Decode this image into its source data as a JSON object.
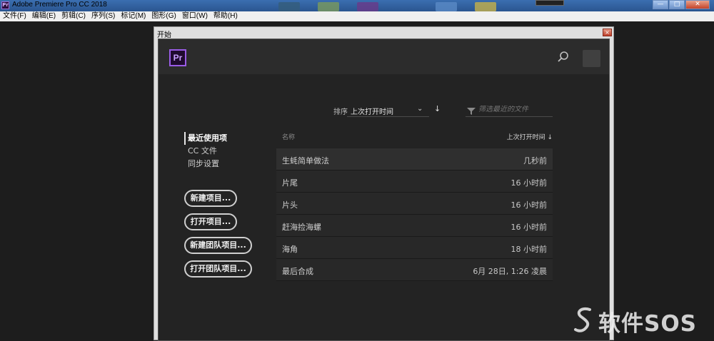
{
  "titlebar": {
    "app_icon": "premiere-icon",
    "app_icon_text": "Pr",
    "title": "Adobe Premiere Pro CC 2018",
    "buttons": [
      "—",
      "□",
      "✕"
    ]
  },
  "menubar": {
    "items": [
      "文件(F)",
      "编辑(E)",
      "剪辑(C)",
      "序列(S)",
      "标记(M)",
      "图形(G)",
      "窗口(W)",
      "帮助(H)"
    ]
  },
  "dialog": {
    "title": "开始",
    "close_label": "×"
  },
  "header": {
    "logo_text": "Pr",
    "search_icon": "search-icon",
    "avatar_icon": "user-avatar"
  },
  "sort": {
    "label": "排序",
    "value": "上次打开时间",
    "chevron": "⌄",
    "direction_icon": "↓"
  },
  "filter": {
    "placeholder": "筛选最近的文件",
    "icon": "filter-funnel-icon"
  },
  "nav": {
    "items": [
      {
        "label": "最近使用项",
        "active": true
      },
      {
        "label": "CC 文件",
        "active": false
      },
      {
        "label": "同步设置",
        "active": false
      }
    ]
  },
  "actions": {
    "new_project": "新建项目...",
    "open_project": "打开项目...",
    "new_team_project": "新建团队项目...",
    "open_team_project": "打开团队项目..."
  },
  "list": {
    "col_name": "名称",
    "col_time": "上次打开时间 ↓",
    "rows": [
      {
        "name": "生蚝简单做法",
        "time": "几秒前"
      },
      {
        "name": "片尾",
        "time": "16 小时前"
      },
      {
        "name": "片头",
        "time": "16 小时前"
      },
      {
        "name": "赶海捡海螺",
        "time": "16 小时前"
      },
      {
        "name": "海角",
        "time": "18 小时前"
      },
      {
        "name": "最后合成",
        "time": "6月 28日, 1:26 凌晨"
      }
    ]
  },
  "watermark": {
    "text": "软件SOS",
    "icon": "swirl-logo-icon"
  },
  "colors": {
    "panel_bg": "#232323",
    "header_bg": "#2c2c2c",
    "logo_accent": "#9a5ce6",
    "row_highlight": "#2f2f2f"
  }
}
